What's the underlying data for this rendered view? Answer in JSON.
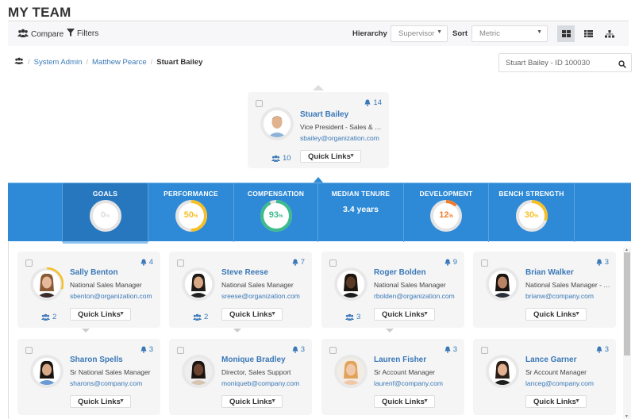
{
  "page": {
    "title": "MY TEAM"
  },
  "toolbar": {
    "compare_label": "Compare",
    "filters_label": "Filters",
    "hierarchy_label": "Hierarchy",
    "hierarchy_value": "Supervisor",
    "sort_label": "Sort",
    "sort_value": "Metric",
    "views": [
      {
        "name": "grid-view",
        "active": true
      },
      {
        "name": "list-view",
        "active": false
      },
      {
        "name": "org-chart-view",
        "active": false
      }
    ]
  },
  "breadcrumb": {
    "items": [
      "System Admin",
      "Matthew Pearce"
    ],
    "current": "Stuart Bailey"
  },
  "search": {
    "value": "Stuart Bailey - ID 100030"
  },
  "focus_person": {
    "name": "Stuart Bailey",
    "role": "Vice President - Sales & Marke...",
    "email": "sbailey@organization.com",
    "alerts": "14",
    "team_count": "10",
    "quick_links": "Quick Links"
  },
  "metrics": [
    {
      "label": "GOALS",
      "type": "gauge",
      "value": 0,
      "display": "0",
      "unit": "%",
      "color": "#d0d0d0",
      "selected": true
    },
    {
      "label": "PERFORMANCE",
      "type": "gauge",
      "value": 50,
      "display": "50",
      "unit": "%",
      "color": "#f6bf26",
      "selected": false
    },
    {
      "label": "COMPENSATION",
      "type": "gauge",
      "value": 93,
      "display": "93",
      "unit": "%",
      "color": "#3dba8e",
      "selected": false
    },
    {
      "label": "MEDIAN TENURE",
      "type": "text",
      "display": "3.4 years",
      "selected": false
    },
    {
      "label": "DEVELOPMENT",
      "type": "gauge",
      "value": 12,
      "display": "12",
      "unit": "%",
      "color": "#f07d2a",
      "selected": false
    },
    {
      "label": "BENCH STRENGTH",
      "type": "gauge",
      "value": 30,
      "display": "30",
      "unit": "%",
      "color": "#f6bf26",
      "selected": false
    }
  ],
  "team": [
    {
      "name": "Sally Benton",
      "role": "National Sales Manager",
      "email": "sbenton@organization.com",
      "alerts": "4",
      "team_count": "2",
      "quick_links": "Quick Links",
      "ring": 0.3
    },
    {
      "name": "Steve Reese",
      "role": "National Sales Manager",
      "email": "sreese@organization.com",
      "alerts": "7",
      "team_count": "2",
      "quick_links": "Quick Links"
    },
    {
      "name": "Roger Bolden",
      "role": "National Sales Manager",
      "email": "rbolden@organization.com",
      "alerts": "9",
      "team_count": "3",
      "quick_links": "Quick Links"
    },
    {
      "name": "Brian Walker",
      "role": "National Sales Manager - US",
      "email": "brianw@company.com",
      "alerts": "3",
      "team_count": null,
      "quick_links": "Quick Links"
    },
    {
      "name": "Sharon Spells",
      "role": "Sr National Sales Manager",
      "email": "sharons@company.com",
      "alerts": "3",
      "team_count": null,
      "quick_links": "Quick Links"
    },
    {
      "name": "Monique Bradley",
      "role": "Director, Sales Support",
      "email": "moniqueb@company.com",
      "alerts": "3",
      "team_count": null,
      "quick_links": "Quick Links"
    },
    {
      "name": "Lauren Fisher",
      "role": "Sr Account Manager",
      "email": "laurenf@company.com",
      "alerts": "3",
      "team_count": null,
      "quick_links": "Quick Links"
    },
    {
      "name": "Lance Garner",
      "role": "Sr Account Manager",
      "email": "lanceg@company.com",
      "alerts": "3",
      "team_count": null,
      "quick_links": "Quick Links"
    }
  ],
  "colors": {
    "accent": "#3a78b7",
    "metric_bar": "#2e8ad6",
    "metric_selected": "#2777be"
  }
}
